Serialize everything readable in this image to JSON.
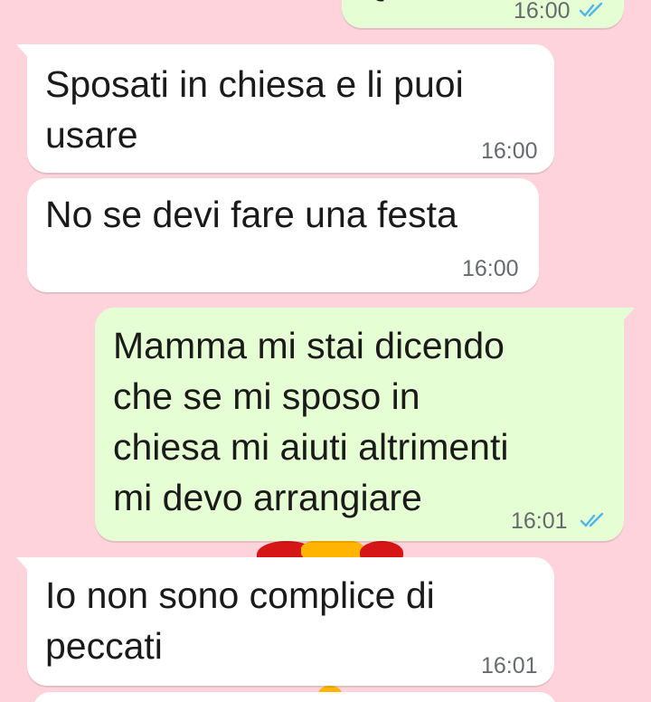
{
  "theme": {
    "wallpaper_color": "#ffd3dc",
    "incoming_bubble_color": "#ffffff",
    "outgoing_bubble_color": "#e6fed3",
    "read_tick_color": "#4fb6ec"
  },
  "messages": [
    {
      "direction": "outgoing",
      "text": "Questo",
      "time": "16:00",
      "status_icon": "double-check-read-icon"
    },
    {
      "direction": "incoming",
      "text": "Sposati in chiesa e li puoi\nusare",
      "time": "16:00"
    },
    {
      "direction": "incoming",
      "text": "No se devi fare una festa",
      "time": "16:00"
    },
    {
      "direction": "outgoing",
      "text": "Mamma mi stai dicendo\nche se mi sposo in\nchiesa mi aiuti altrimenti\nmi devo arrangiare",
      "time": "16:01",
      "status_icon": "double-check-read-icon"
    },
    {
      "direction": "incoming",
      "text": "Io non sono complice di\npeccati",
      "time": "16:01"
    }
  ]
}
